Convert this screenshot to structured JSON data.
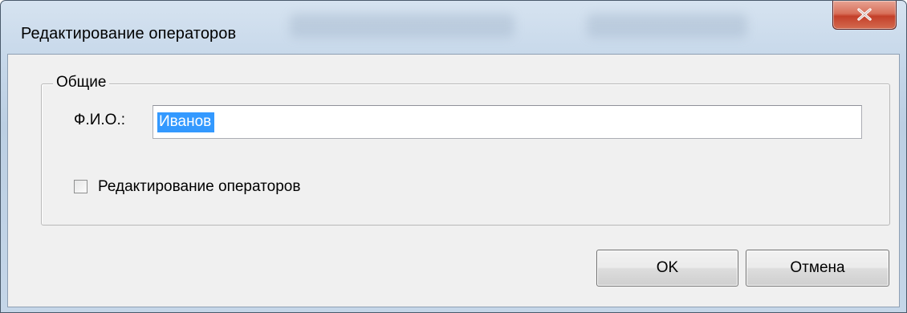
{
  "window": {
    "title": "Редактирование операторов"
  },
  "group": {
    "legend": "Общие",
    "fio_label": "Ф.И.О.:",
    "fio_value": "Иванов",
    "checkbox_label": "Редактирование операторов",
    "checkbox_checked": false
  },
  "buttons": {
    "ok": "OK",
    "cancel": "Отмена"
  },
  "icons": {
    "close": "close-icon"
  },
  "colors": {
    "selection": "#3399ff",
    "close_button": "#c3402a",
    "dialog_background": "#f0f0f0"
  }
}
